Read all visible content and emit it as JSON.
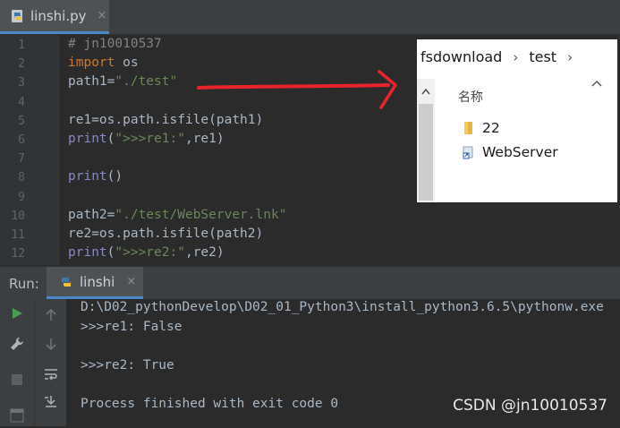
{
  "editor_tab": {
    "filename": "linshi.py",
    "close": "×"
  },
  "code_lines": [
    {
      "no": "1",
      "tokens": [
        {
          "t": "# jn10010537",
          "c": "cmt"
        }
      ]
    },
    {
      "no": "2",
      "tokens": [
        {
          "t": "import",
          "c": "kw"
        },
        {
          "t": " os",
          "c": ""
        }
      ]
    },
    {
      "no": "3",
      "tokens": [
        {
          "t": "path1=",
          "c": ""
        },
        {
          "t": "\"./test\"",
          "c": "str"
        }
      ]
    },
    {
      "no": "4",
      "tokens": []
    },
    {
      "no": "5",
      "tokens": [
        {
          "t": "re1=os.path.isfile(path1)",
          "c": ""
        }
      ]
    },
    {
      "no": "6",
      "tokens": [
        {
          "t": "print",
          "c": "fn"
        },
        {
          "t": "(",
          "c": ""
        },
        {
          "t": "\">>>re1:\"",
          "c": "str"
        },
        {
          "t": ",re1)",
          "c": ""
        }
      ]
    },
    {
      "no": "7",
      "tokens": []
    },
    {
      "no": "8",
      "tokens": [
        {
          "t": "print",
          "c": "fn"
        },
        {
          "t": "()",
          "c": ""
        }
      ]
    },
    {
      "no": "9",
      "tokens": []
    },
    {
      "no": "10",
      "tokens": [
        {
          "t": "path2=",
          "c": ""
        },
        {
          "t": "\"./test/WebServer.lnk\"",
          "c": "str"
        }
      ]
    },
    {
      "no": "11",
      "tokens": [
        {
          "t": "re2=os.path.isfile(path2)",
          "c": ""
        }
      ]
    },
    {
      "no": "12",
      "tokens": [
        {
          "t": "print",
          "c": "fn"
        },
        {
          "t": "(",
          "c": ""
        },
        {
          "t": "\">>>re2:\"",
          "c": "str"
        },
        {
          "t": ",re2)",
          "c": ""
        }
      ]
    }
  ],
  "explorer": {
    "breadcrumb": [
      "fsdownload",
      "test"
    ],
    "column_header": "名称",
    "items": [
      {
        "name": "22",
        "icon": "folder-icon"
      },
      {
        "name": "WebServer",
        "icon": "shortcut-icon"
      }
    ]
  },
  "run": {
    "label": "Run:",
    "tab": "linshi",
    "close": "×",
    "console": [
      "D:\\D02_pythonDevelop\\D02_01_Python3\\install_python3.6.5\\pythonw.exe",
      ">>>re1: False",
      "",
      ">>>re2: True",
      "",
      "Process finished with exit code 0"
    ]
  },
  "watermark": "CSDN @jn10010537",
  "colors": {
    "keyword": "#cc7832",
    "string": "#6a8759",
    "comment": "#808080",
    "annotation": "#e8232b"
  }
}
